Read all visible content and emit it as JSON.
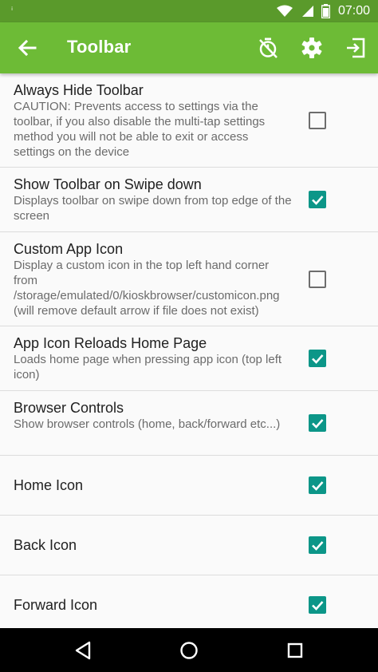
{
  "status_bar": {
    "notification_icon": "dot-icon",
    "wifi_icon": "wifi-icon",
    "signal_icon": "signal-icon",
    "battery_icon": "battery-icon",
    "time": "07:00"
  },
  "app_bar": {
    "title": "Toolbar",
    "icons": [
      "back-arrow-icon",
      "timer-off-icon",
      "gear-icon",
      "exit-icon"
    ],
    "color": "#6dbb36"
  },
  "settings": [
    {
      "title": "Always Hide Toolbar",
      "description": "CAUTION: Prevents access to settings via the toolbar, if you also disable the multi-tap settings method you will not be able to exit or access settings on the device",
      "checked": false
    },
    {
      "title": "Show Toolbar on Swipe down",
      "description": "Displays toolbar on swipe down from top edge of the screen",
      "checked": true
    },
    {
      "title": "Custom App Icon",
      "description": "Display a custom icon in the top left hand corner from /storage/emulated/0/kioskbrowser/customicon.png (will remove default arrow if file does not exist)",
      "checked": false
    },
    {
      "title": "App Icon Reloads Home Page",
      "description": "Loads home page when pressing app icon (top left icon)",
      "checked": true
    },
    {
      "title": "Browser Controls",
      "description": "Show browser controls (home, back/forward etc...)",
      "checked": true
    },
    {
      "title": "Home Icon",
      "description": "",
      "checked": true
    },
    {
      "title": "Back Icon",
      "description": "",
      "checked": true
    },
    {
      "title": "Forward Icon",
      "description": "",
      "checked": true
    }
  ],
  "nav_bar": {
    "icons": [
      "nav-back-icon",
      "nav-home-icon",
      "nav-recents-icon"
    ]
  },
  "colors": {
    "status_bar": "#5a9a2b",
    "accent": "#0c9688"
  }
}
